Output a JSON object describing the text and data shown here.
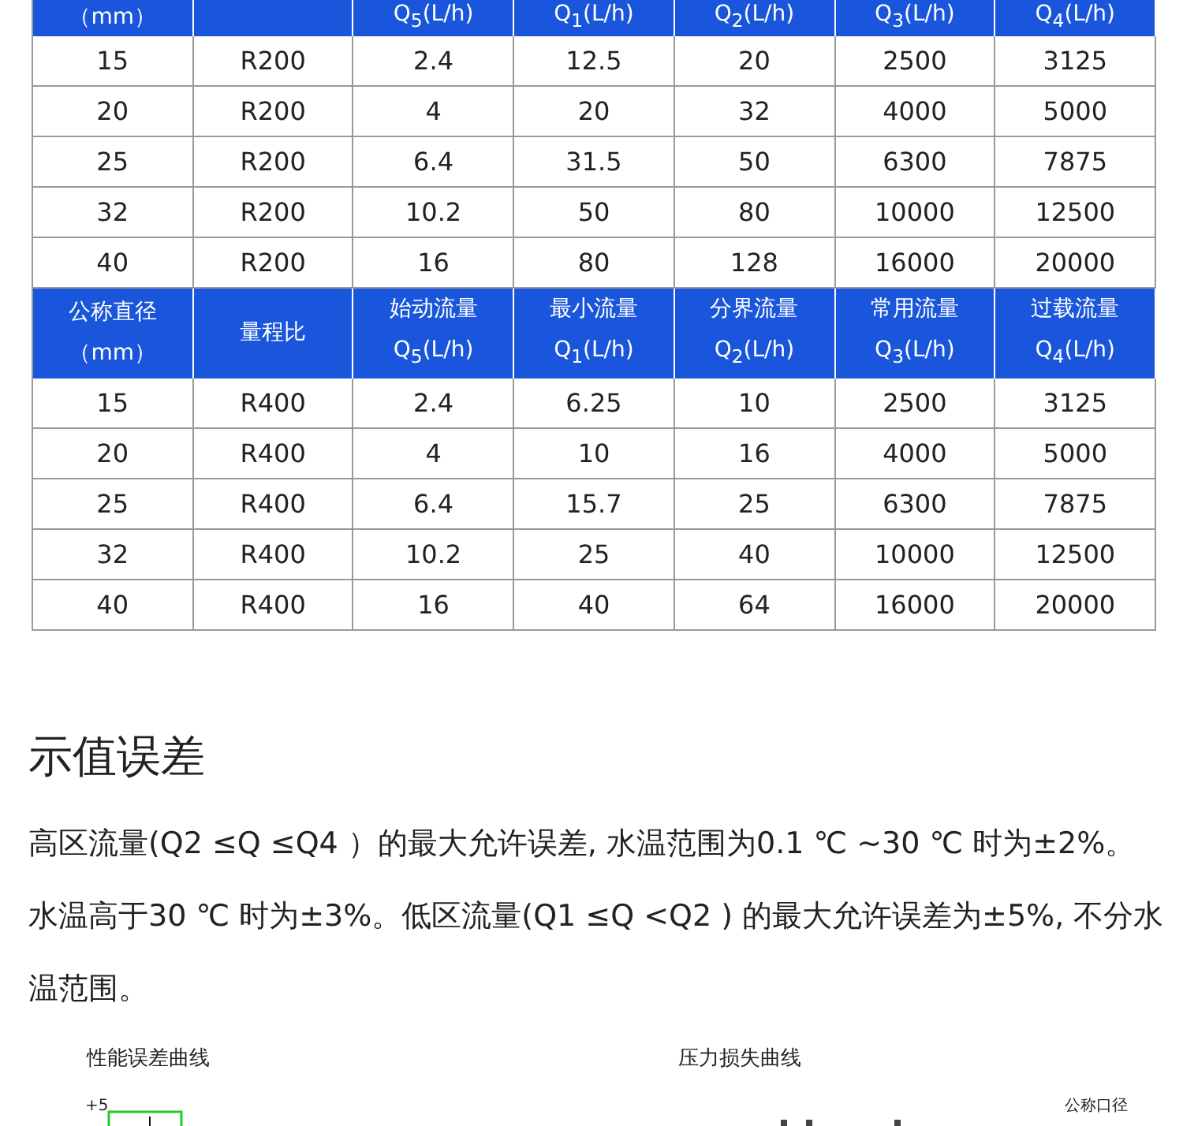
{
  "tables": [
    {
      "header": {
        "column_1": "（mm）",
        "column_3": "Q$_{5}$(L/h)",
        "column_4": "Q$_{1}$(L/h)",
        "column_5": "Q$_{2}$(L/h)",
        "column_6": "Q$_{3}$(L/h)",
        "column_7": "Q$_{4}$(L/h)"
      },
      "rows": [
        [
          "15",
          "R200",
          "2.4",
          "12.5",
          "20",
          "2500",
          "3125"
        ],
        [
          "20",
          "R200",
          "4",
          "20",
          "32",
          "4000",
          "5000"
        ],
        [
          "25",
          "R200",
          "6.4",
          "31.5",
          "50",
          "6300",
          "7875"
        ],
        [
          "32",
          "R200",
          "10.2",
          "50",
          "80",
          "10000",
          "12500"
        ],
        [
          "40",
          "R200",
          "16",
          "80",
          "128",
          "16000",
          "20000"
        ]
      ]
    },
    {
      "header": [
        "公称直径（mm）",
        "量程比",
        "始动流量Q$_{5}$(L/h)",
        "最小流量Q$_{1}$(L/h)",
        "分界流量Q$_{2}$(L/h)",
        "常用流量Q$_{3}$(L/h)",
        "过载流量Q$_{4}$(L/h)"
      ],
      "rows": [
        [
          "15",
          "R400",
          "2.4",
          "6.25",
          "10",
          "2500",
          "3125"
        ],
        [
          "20",
          "R400",
          "4",
          "10",
          "16",
          "4000",
          "5000"
        ],
        [
          "25",
          "R400",
          "6.4",
          "15.7",
          "25",
          "6300",
          "7875"
        ],
        [
          "32",
          "R400",
          "10.2",
          "25",
          "40",
          "10000",
          "12500"
        ],
        [
          "40",
          "R400",
          "16",
          "40",
          "64",
          "16000",
          "20000"
        ]
      ]
    }
  ],
  "section": {
    "title": "示值误差",
    "text": "高区流量(Q2 ≤Q ≤Q4 ）的最大允许误差, 水温范围为0.1 ℃ ~30 ℃ 时为±2%。水温高于30 ℃ 时为±3%。低区流量(Q1 ≤Q <Q2 ) 的最大允许误差为±5%, 不分水温范围。"
  },
  "charts": [
    {
      "title": "性能误差曲线",
      "kind": "error",
      "labels": [
        "+5"
      ]
    },
    {
      "title": "压力损失曲线",
      "kind": "pressure",
      "labels": [
        "公称口径"
      ]
    }
  ]
}
